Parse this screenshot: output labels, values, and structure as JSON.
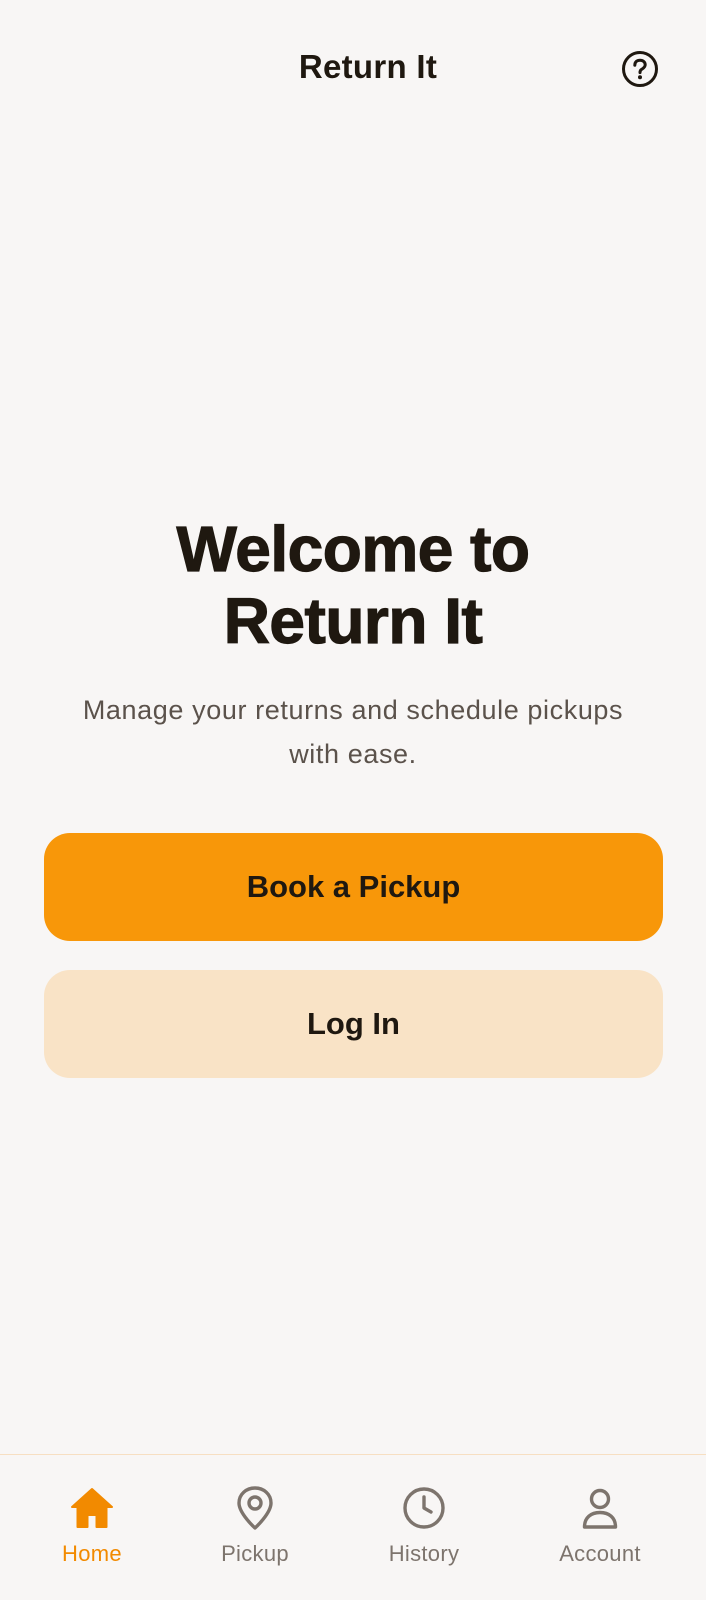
{
  "header": {
    "title": "Return It",
    "help_icon": "help-circle-icon"
  },
  "hero": {
    "title_line1": "Welcome to",
    "title_line2": "Return It",
    "subtitle_line1": "Manage your returns and schedule pickups",
    "subtitle_line2": "with ease."
  },
  "actions": {
    "primary_label": "Book a Pickup",
    "secondary_label": "Log In"
  },
  "nav": {
    "items": [
      {
        "label": "Home",
        "icon": "home-icon",
        "active": true
      },
      {
        "label": "Pickup",
        "icon": "location-pin-icon",
        "active": false
      },
      {
        "label": "History",
        "icon": "clock-icon",
        "active": false
      },
      {
        "label": "Account",
        "icon": "person-icon",
        "active": false
      }
    ]
  },
  "colors": {
    "background": "#f8f6f5",
    "accent": "#f89709",
    "accent_soft": "#f9e3c6",
    "text_dark": "#1f1810",
    "text_muted": "#5b524b",
    "nav_inactive": "#7d746d",
    "nav_active": "#f28a00"
  }
}
